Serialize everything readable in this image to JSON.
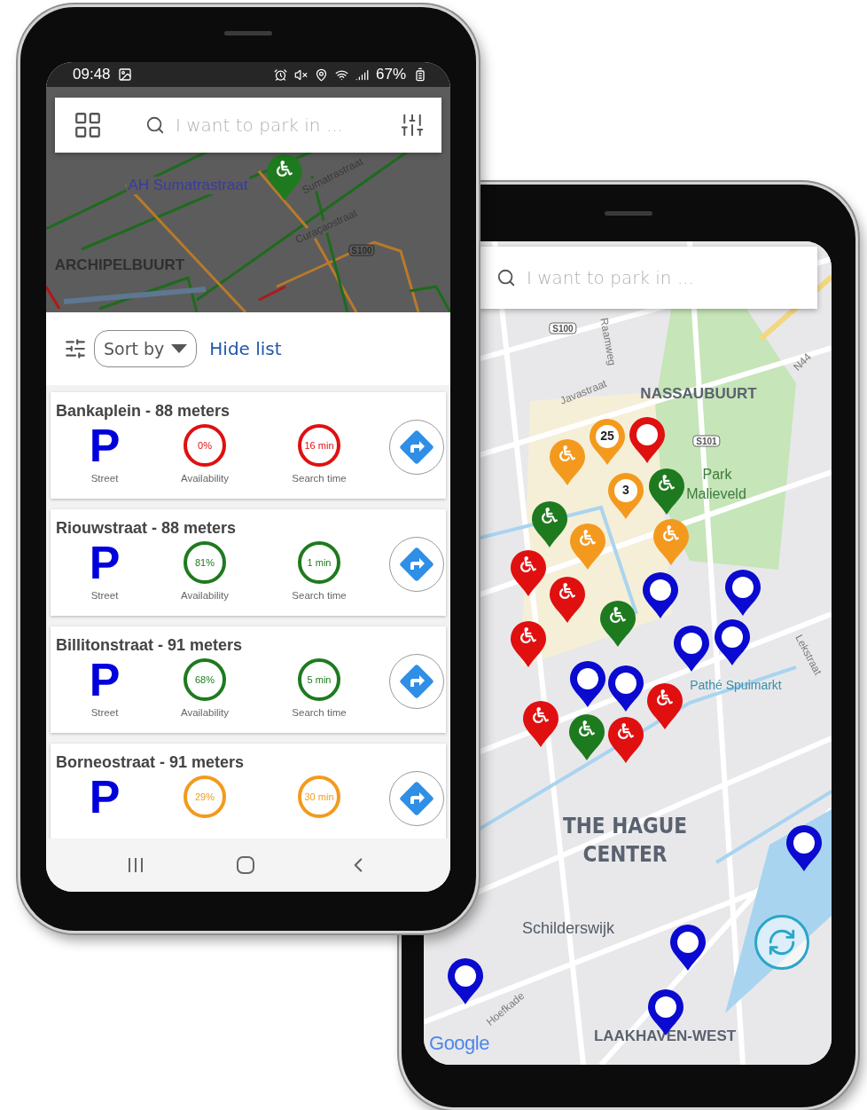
{
  "left_phone": {
    "status_bar": {
      "time": "09:48",
      "battery": "67%"
    },
    "search": {
      "placeholder": "I want to park in ..."
    },
    "map": {
      "labels": [
        {
          "text": "AH Sumatrastraat",
          "kind": "poi"
        },
        {
          "text": "Sumatrastraat",
          "kind": "street"
        },
        {
          "text": "Curaçaostraat",
          "kind": "street"
        },
        {
          "text": "ARCHIPELBUURT",
          "kind": "district"
        },
        {
          "text": "S100",
          "kind": "shield"
        }
      ],
      "pins": [
        {
          "color": "#1e7a1e",
          "kind": "wheelchair"
        }
      ]
    },
    "list_toolbar": {
      "sort": "Sort by",
      "hide": "Hide list"
    },
    "results": [
      {
        "title": "Bankaplein - 88 meters",
        "symbol": "P",
        "type_label": "Street",
        "availability": "0%",
        "availability_label": "Availability",
        "search_time": "16 min",
        "search_time_label": "Search time",
        "color": "#e01010"
      },
      {
        "title": "Riouwstraat - 88 meters",
        "symbol": "P",
        "type_label": "Street",
        "availability": "81%",
        "availability_label": "Availability",
        "search_time": "1 min",
        "search_time_label": "Search time",
        "color": "#1e7a1e"
      },
      {
        "title": "Billitonstraat - 91 meters",
        "symbol": "P",
        "type_label": "Street",
        "availability": "68%",
        "availability_label": "Availability",
        "search_time": "5 min",
        "search_time_label": "Search time",
        "color": "#1e7a1e"
      },
      {
        "title": "Borneostraat - 91 meters",
        "symbol": "P",
        "availability": "29%",
        "search_time": "30 min",
        "color": "#f39a1e"
      }
    ]
  },
  "right_phone": {
    "search": {
      "placeholder": "I want to park in ..."
    },
    "map": {
      "labels": [
        {
          "text": "S100",
          "kind": "shield"
        },
        {
          "text": "Raamweg",
          "kind": "street"
        },
        {
          "text": "NASSAUBUURT",
          "kind": "district"
        },
        {
          "text": "Javastraat",
          "kind": "street"
        },
        {
          "text": "N44",
          "kind": "street"
        },
        {
          "text": "S101",
          "kind": "shield"
        },
        {
          "text": "Park",
          "kind": "park"
        },
        {
          "text": "Malieveld",
          "kind": "park"
        },
        {
          "text": "Pathé Spuimarkt",
          "kind": "poi"
        },
        {
          "text": "Lekstraat",
          "kind": "street"
        },
        {
          "text": "THE HAGUE",
          "kind": "city"
        },
        {
          "text": "CENTER",
          "kind": "city"
        },
        {
          "text": "Schilderswijk",
          "kind": "neighborhood"
        },
        {
          "text": "Hoefkade",
          "kind": "street"
        },
        {
          "text": "Google",
          "kind": "logo"
        },
        {
          "text": "LAAKHAVEN-WEST",
          "kind": "district"
        }
      ],
      "pins": [
        {
          "color": "#f39a1e",
          "kind": "wheelchair"
        },
        {
          "color": "#e01010",
          "kind": "ring"
        },
        {
          "color": "#1e7a1e",
          "kind": "wheelchair"
        },
        {
          "color": "#1e7a1e",
          "kind": "wheelchair"
        },
        {
          "color": "#f39a1e",
          "kind": "wheelchair"
        },
        {
          "color": "#f39a1e",
          "kind": "wheelchair"
        },
        {
          "color": "#e01010",
          "kind": "wheelchair"
        },
        {
          "color": "#0a0ad0",
          "kind": "ring"
        },
        {
          "color": "#0a0ad0",
          "kind": "ring"
        },
        {
          "color": "#1e7a1e",
          "kind": "wheelchair"
        },
        {
          "color": "#e01010",
          "kind": "wheelchair"
        },
        {
          "color": "#0a0ad0",
          "kind": "ring"
        },
        {
          "color": "#0a0ad0",
          "kind": "ring"
        },
        {
          "color": "#0a0ad0",
          "kind": "ring"
        },
        {
          "color": "#0a0ad0",
          "kind": "ring"
        },
        {
          "color": "#e01010",
          "kind": "wheelchair"
        },
        {
          "color": "#e01010",
          "kind": "wheelchair"
        },
        {
          "color": "#1e7a1e",
          "kind": "wheelchair"
        },
        {
          "color": "#e01010",
          "kind": "wheelchair"
        },
        {
          "color": "#0a0ad0",
          "kind": "ring"
        },
        {
          "color": "#0a0ad0",
          "kind": "ring"
        },
        {
          "color": "#0a0ad0",
          "kind": "ring"
        },
        {
          "color": "#0a0ad0",
          "kind": "ring"
        },
        {
          "color": "#e01010",
          "kind": "wheelchair"
        },
        {
          "color": "#f39a1e",
          "kind": "count",
          "count": "25"
        },
        {
          "color": "#f39a1e",
          "kind": "count",
          "count": "3"
        }
      ]
    }
  }
}
